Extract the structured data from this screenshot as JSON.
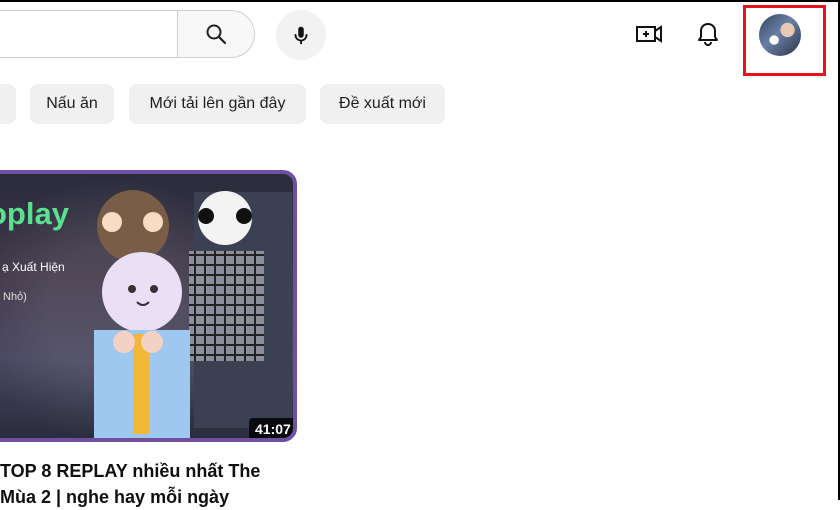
{
  "header": {
    "search_icon": "search-icon",
    "mic_icon": "mic-icon",
    "create_icon": "create-video-icon",
    "notifications_icon": "bell-icon",
    "avatar_icon": "account-avatar"
  },
  "chips": [
    {
      "label": "Nấu ăn"
    },
    {
      "label": "Mới tải lên gần đây"
    },
    {
      "label": "Đề xuất mới"
    }
  ],
  "video": {
    "thumbnail_title": "oplay",
    "thumbnail_line1": "ạ Xuất Hiện",
    "thumbnail_line2": "Nhỏ)",
    "duration": "41:07",
    "title_line1": "TOP 8 REPLAY nhiều nhất The",
    "title_line2": "Mùa 2 | nghe hay mỗi ngày"
  },
  "colors": {
    "highlight": "#e8111a",
    "chip_bg": "#f0f0f0",
    "thumb_border": "#6f4f9f"
  }
}
